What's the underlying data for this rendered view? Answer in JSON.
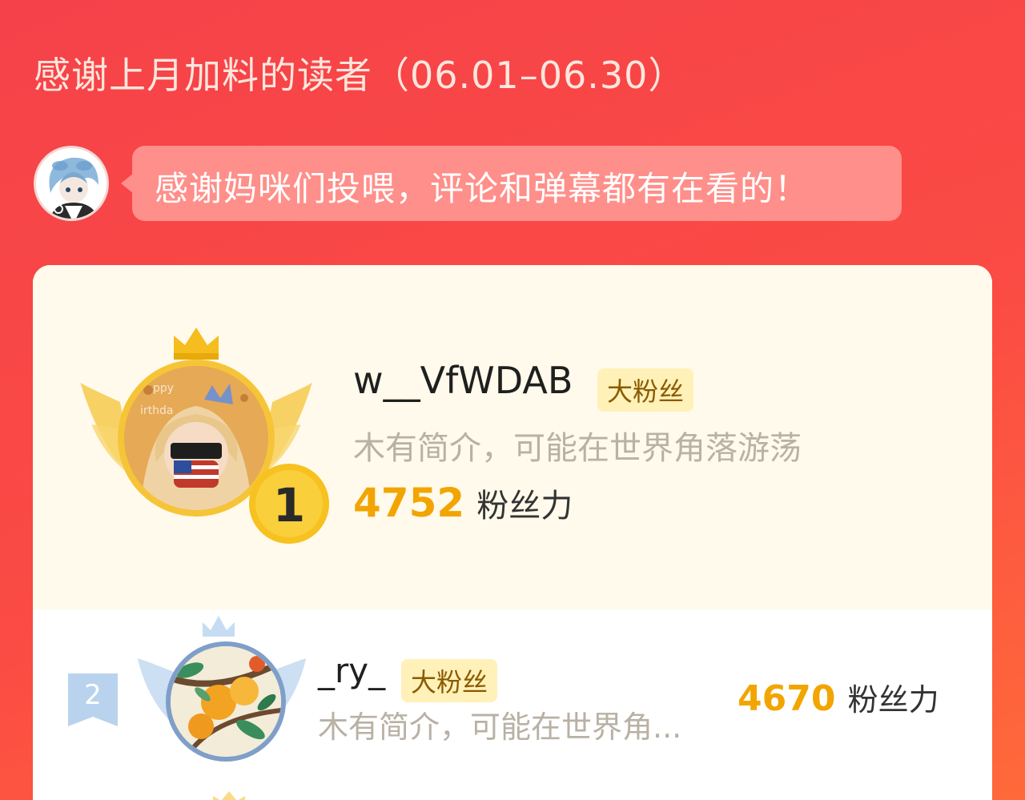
{
  "header": {
    "title": "感谢上月加料的读者（06.01–06.30）"
  },
  "author_message": {
    "avatar_icon": "author-avatar-icon",
    "text": "感谢妈咪们投喂，评论和弹幕都有在看的！"
  },
  "leaderboard": {
    "entries": [
      {
        "rank": "1",
        "name": "w__VfWDAB",
        "badge": "大粉丝",
        "description": "木有简介，可能在世界角落游荡",
        "score": "4752",
        "score_unit": "粉丝力",
        "avatar_icon": "reader-avatar-icon",
        "crown_icon": "gold-crown-icon"
      },
      {
        "rank": "2",
        "name": "_ry_",
        "badge": "大粉丝",
        "description": "木有简介，可能在世界角...",
        "score": "4670",
        "score_unit": "粉丝力",
        "avatar_icon": "reader-avatar-icon",
        "crown_icon": "silver-crown-icon"
      }
    ]
  },
  "colors": {
    "background": "#f5424a",
    "accent_gold": "#f2a500",
    "badge_bg": "#fff1b8",
    "top_block_bg": "#fffaeb",
    "speech_bg": "#ff8f8a"
  }
}
